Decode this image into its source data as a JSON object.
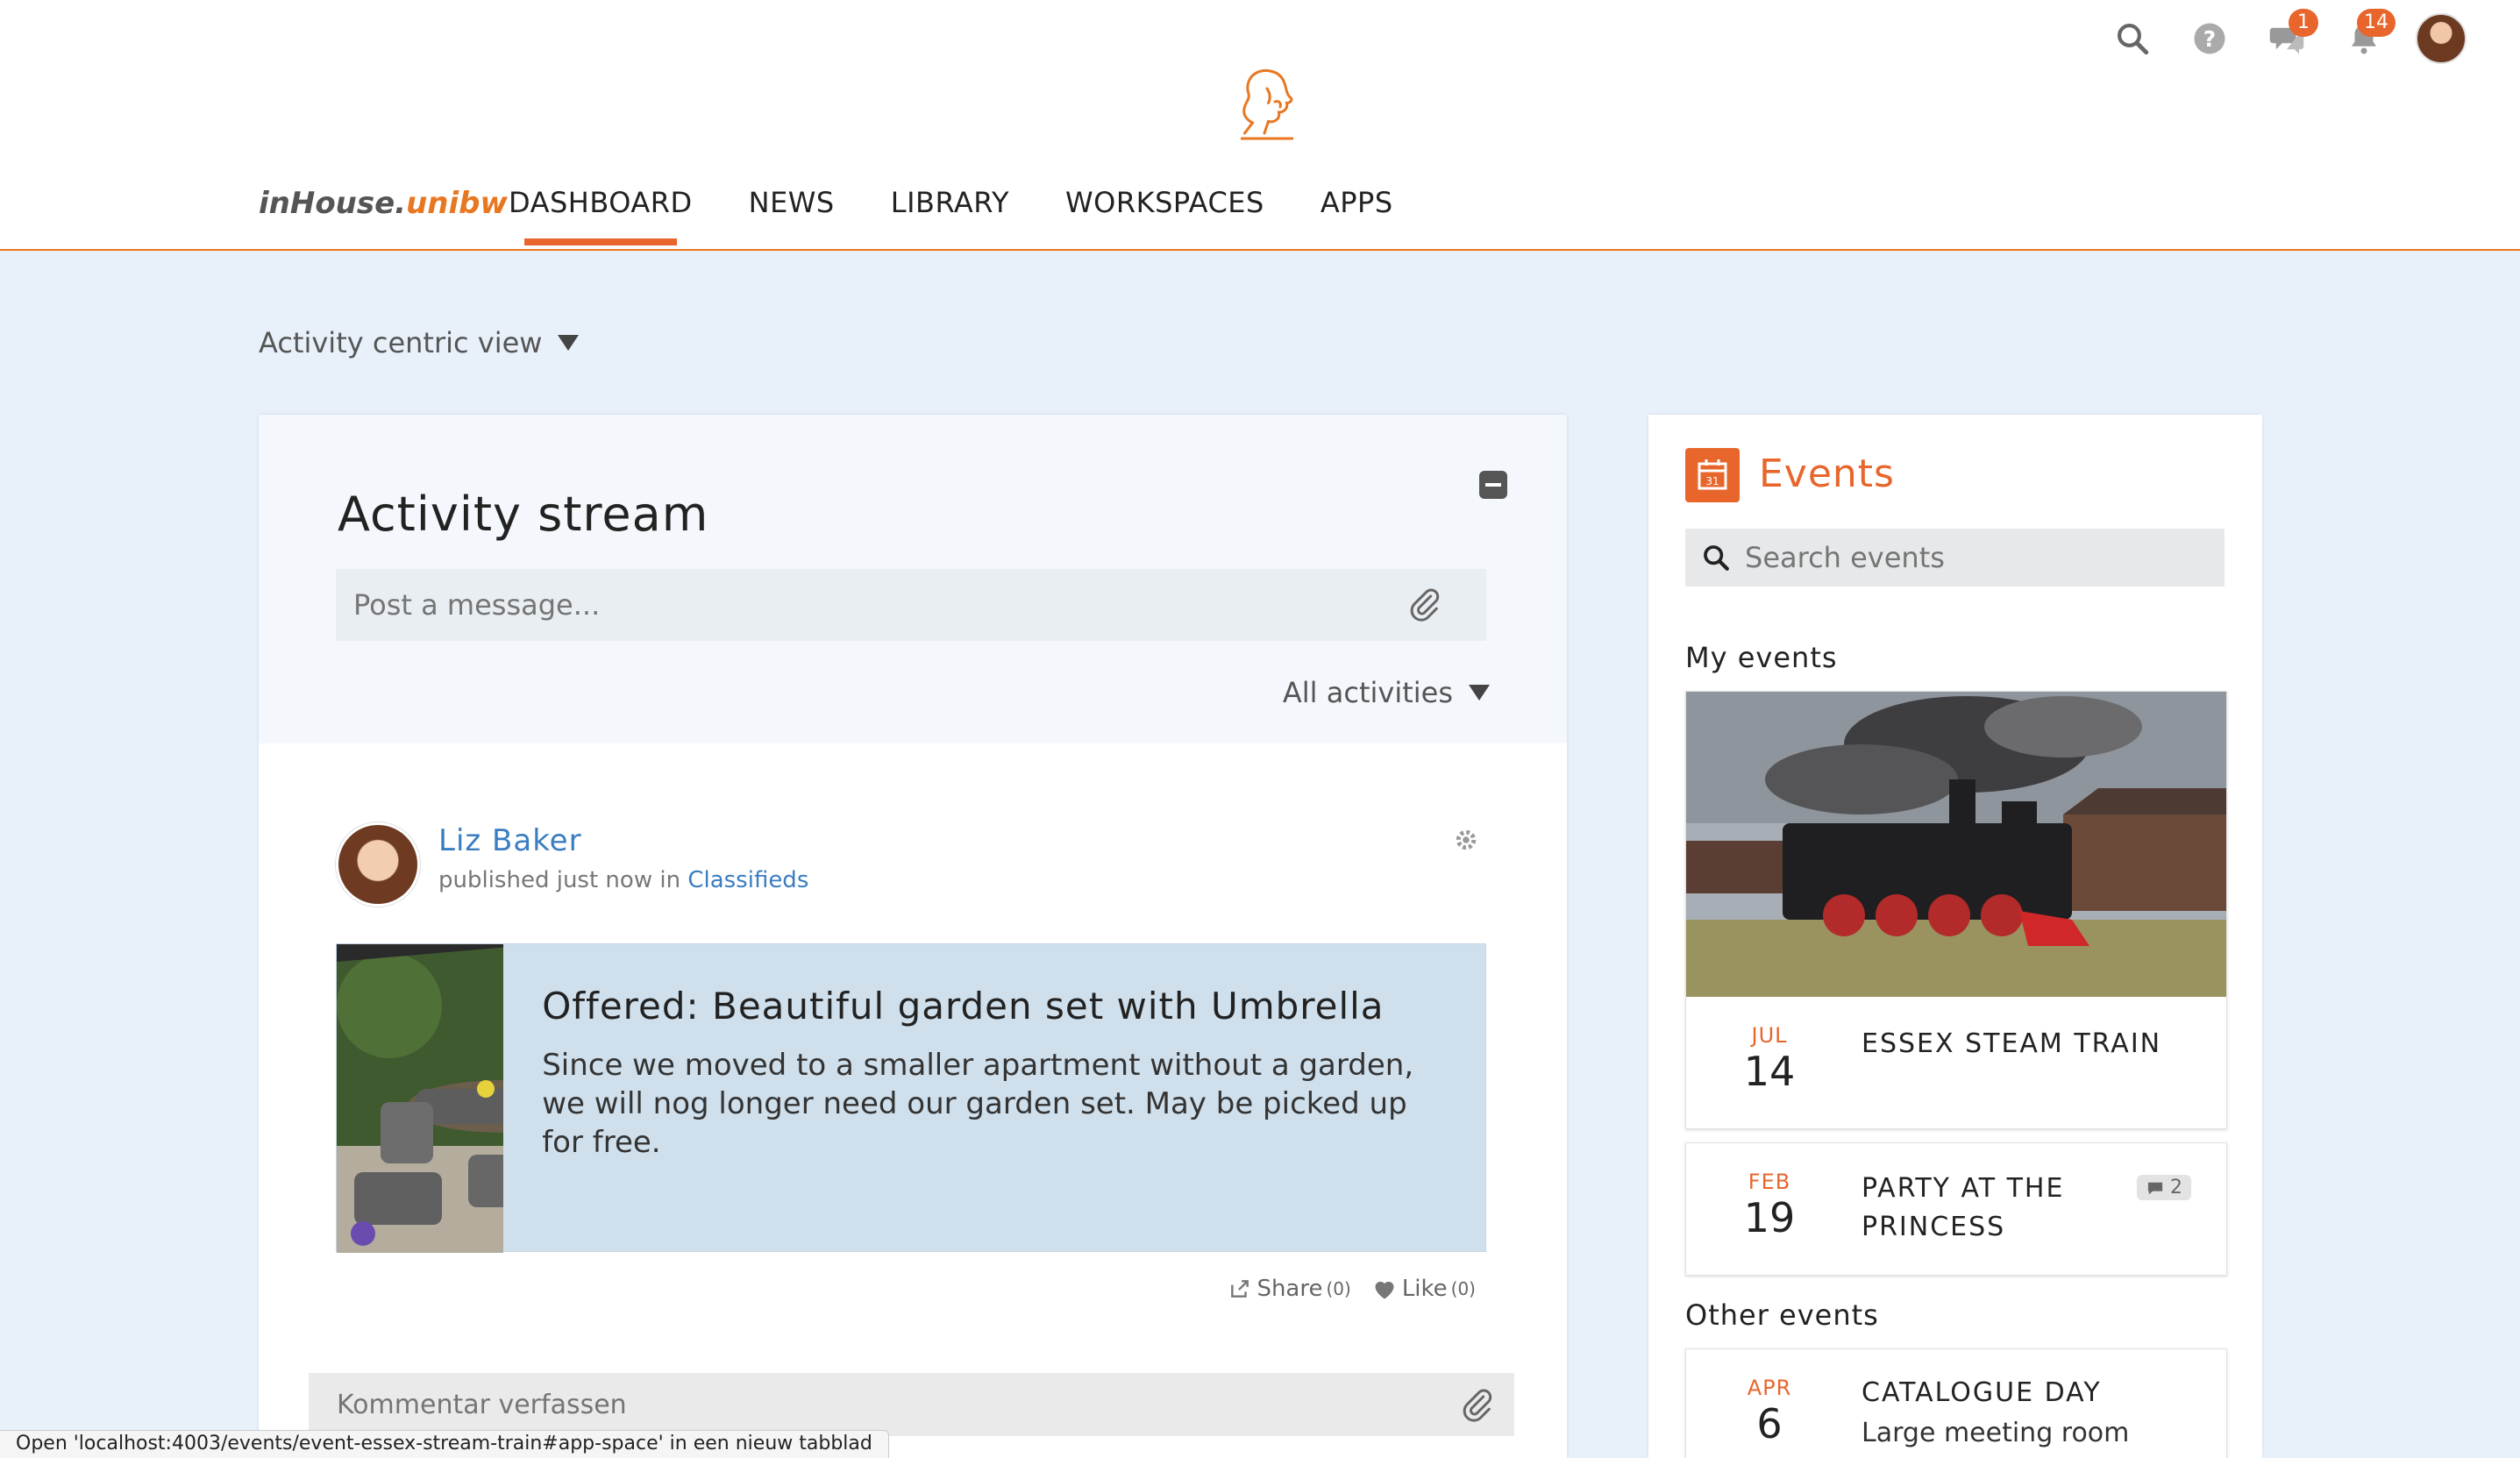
{
  "header": {
    "brand_prefix": "inHouse.",
    "brand_suffix": "unibw",
    "notifications": {
      "messages_count": "1",
      "alerts_count": "14"
    },
    "icons": [
      "search-icon",
      "help-icon",
      "chat-icon",
      "bell-icon"
    ]
  },
  "nav": {
    "items": [
      {
        "label": "DASHBOARD",
        "active": true
      },
      {
        "label": "NEWS"
      },
      {
        "label": "LIBRARY"
      },
      {
        "label": "WORKSPACES"
      },
      {
        "label": "APPS"
      }
    ]
  },
  "view_switch": {
    "label": "Activity centric view"
  },
  "activity": {
    "title": "Activity stream",
    "post_placeholder": "Post a message...",
    "filter_label": "All activities",
    "post": {
      "author": "Liz Baker",
      "meta_prefix": "published just now in ",
      "meta_link": "Classifieds",
      "title": "Offered: Beautiful garden set with Umbrella",
      "body": "Since we moved to a smaller apartment without a garden, we will nog longer need our garden set. May be picked up for free.",
      "share_label": "Share",
      "share_count": "(0)",
      "like_label": "Like",
      "like_count": "(0)"
    },
    "comment_placeholder": "Kommentar verfassen"
  },
  "events": {
    "title": "Events",
    "calendar_icon_day": "31",
    "search_placeholder": "Search events",
    "my_events_label": "My events",
    "other_events_label": "Other events",
    "my_events": [
      {
        "month": "JUL",
        "day": "14",
        "name": "ESSEX STEAM TRAIN"
      },
      {
        "month": "FEB",
        "day": "19",
        "name_line1": "PARTY AT THE",
        "name_line2": "PRINCESS",
        "comments": "2"
      }
    ],
    "other_events": [
      {
        "month": "APR",
        "day": "6",
        "name": "CATALOGUE DAY",
        "location": "Large meeting room"
      }
    ]
  },
  "status_bar": {
    "text": "Open 'localhost:4003/events/event-essex-stream-train#app-space' in een nieuw tabblad"
  },
  "colors": {
    "accent": "#e8662c",
    "link": "#3a7dc0",
    "page_bg": "#e8f1fa"
  }
}
